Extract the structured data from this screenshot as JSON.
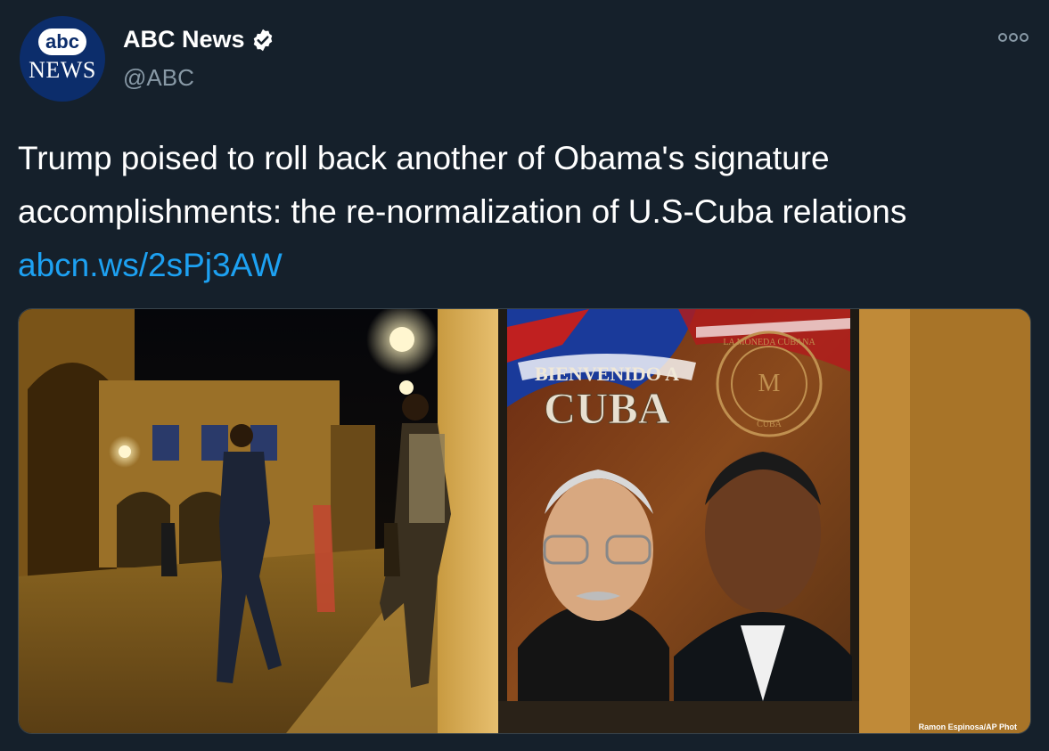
{
  "tweet": {
    "display_name": "ABC News",
    "handle": "@ABC",
    "text": "Trump poised to roll back another of Obama's signature accomplishments: the re-normalization of U.S-Cuba relations ",
    "link": "abcn.ws/2sPj3AW"
  },
  "avatar": {
    "logo_top": "abc",
    "logo_bottom": "NEWS"
  },
  "media": {
    "poster_line1": "BIENVENIDO A",
    "poster_line2": "CUBA",
    "seal_text": "LA MONEDA CUBANA",
    "seal_bottom": "CUBA",
    "credit": "Ramon Espinosa/AP Phot"
  },
  "colors": {
    "background": "#15202b",
    "link": "#1da1f2",
    "secondary_text": "#8899a6",
    "brand": "#0c2d6b"
  }
}
